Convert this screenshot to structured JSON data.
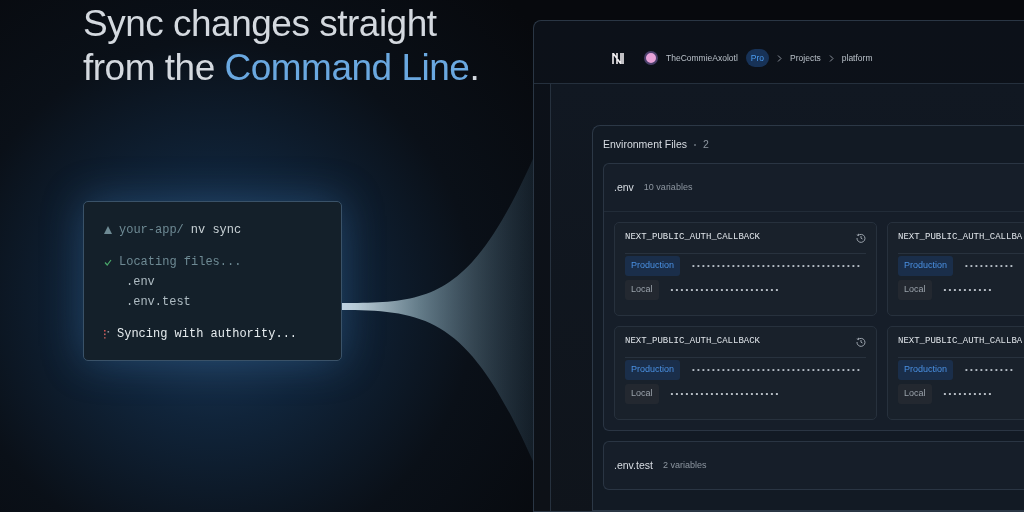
{
  "headline": {
    "lines": [
      [
        {
          "text": "Sync changes straight",
          "highlight": false
        }
      ],
      [
        {
          "text": "from the ",
          "highlight": false
        },
        {
          "text": "Command Line",
          "highlight": true
        },
        {
          "text": ".",
          "highlight": false
        }
      ]
    ]
  },
  "terminal": {
    "lines": [
      {
        "kind": "command",
        "path": "your-app/",
        "command": "nv sync"
      },
      {
        "kind": "success",
        "text": "Locating files..."
      },
      {
        "kind": "file",
        "text": ".env"
      },
      {
        "kind": "file",
        "text": ".env.test"
      },
      {
        "kind": "progress",
        "text": "Syncing with authority..."
      }
    ]
  },
  "app": {
    "breadcrumb": {
      "user": "TheCommieAxolotl",
      "plan": "Pro",
      "items": [
        "Projects",
        "platform"
      ]
    },
    "environment_files": {
      "title": "Environment Files",
      "count": "2",
      "files": [
        {
          "name": ".env",
          "count": "10 variables",
          "variables": [
            {
              "name": "NEXT_PUBLIC_AUTH_CALLBACK",
              "values": [
                {
                  "env": "Production",
                  "kind": "production",
                  "masked": "••••••••••••••••••••••••••••••••••"
                },
                {
                  "env": "Local",
                  "kind": "local",
                  "masked": "••••••••••••••••••••••"
                }
              ]
            },
            {
              "name": "NEXT_PUBLIC_AUTH_CALLBA",
              "values": [
                {
                  "env": "Production",
                  "kind": "production",
                  "masked": "••••••••••"
                },
                {
                  "env": "Local",
                  "kind": "local",
                  "masked": "••••••••••"
                }
              ]
            },
            {
              "name": "NEXT_PUBLIC_AUTH_CALLBACK",
              "values": [
                {
                  "env": "Production",
                  "kind": "production",
                  "masked": "••••••••••••••••••••••••••••••••••"
                },
                {
                  "env": "Local",
                  "kind": "local",
                  "masked": "••••••••••••••••••••••"
                }
              ]
            },
            {
              "name": "NEXT_PUBLIC_AUTH_CALLBA",
              "values": [
                {
                  "env": "Production",
                  "kind": "production",
                  "masked": "••••••••••"
                },
                {
                  "env": "Local",
                  "kind": "local",
                  "masked": "••••••••••"
                }
              ]
            }
          ]
        },
        {
          "name": ".env.test",
          "count": "2 variables"
        }
      ]
    }
  }
}
